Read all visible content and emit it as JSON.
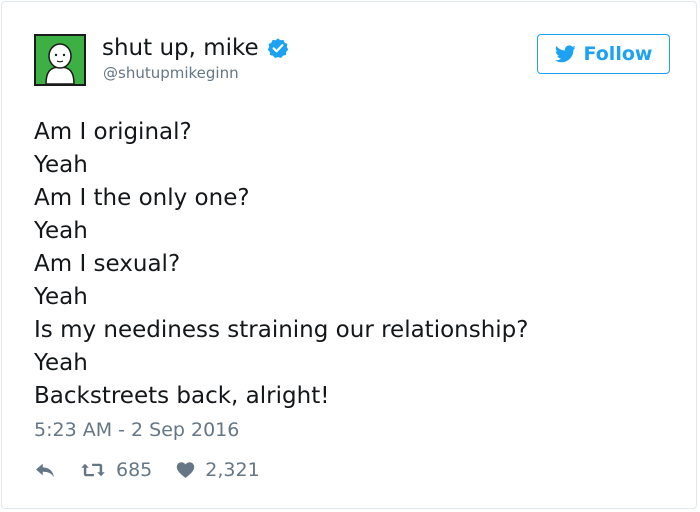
{
  "user": {
    "display_name": "shut up, mike",
    "handle": "@shutupmikeginn",
    "verified": true,
    "avatar_icon": "cartoon-person-avatar",
    "avatar_bg": "#3cb043"
  },
  "follow_button": {
    "label": "Follow",
    "icon": "twitter-bird-icon",
    "color": "#1da1f2"
  },
  "tweet": {
    "lines": [
      "Am I original?",
      "Yeah",
      "Am I the only one?",
      "Yeah",
      "Am I sexual?",
      "Yeah",
      "Is my neediness straining our relationship?",
      "Yeah",
      "Backstreets back, alright!"
    ],
    "timestamp": "5:23 AM - 2 Sep 2016"
  },
  "actions": {
    "reply_icon": "reply-icon",
    "retweet_icon": "retweet-icon",
    "retweet_count": "685",
    "like_icon": "heart-icon",
    "like_count": "2,321"
  }
}
